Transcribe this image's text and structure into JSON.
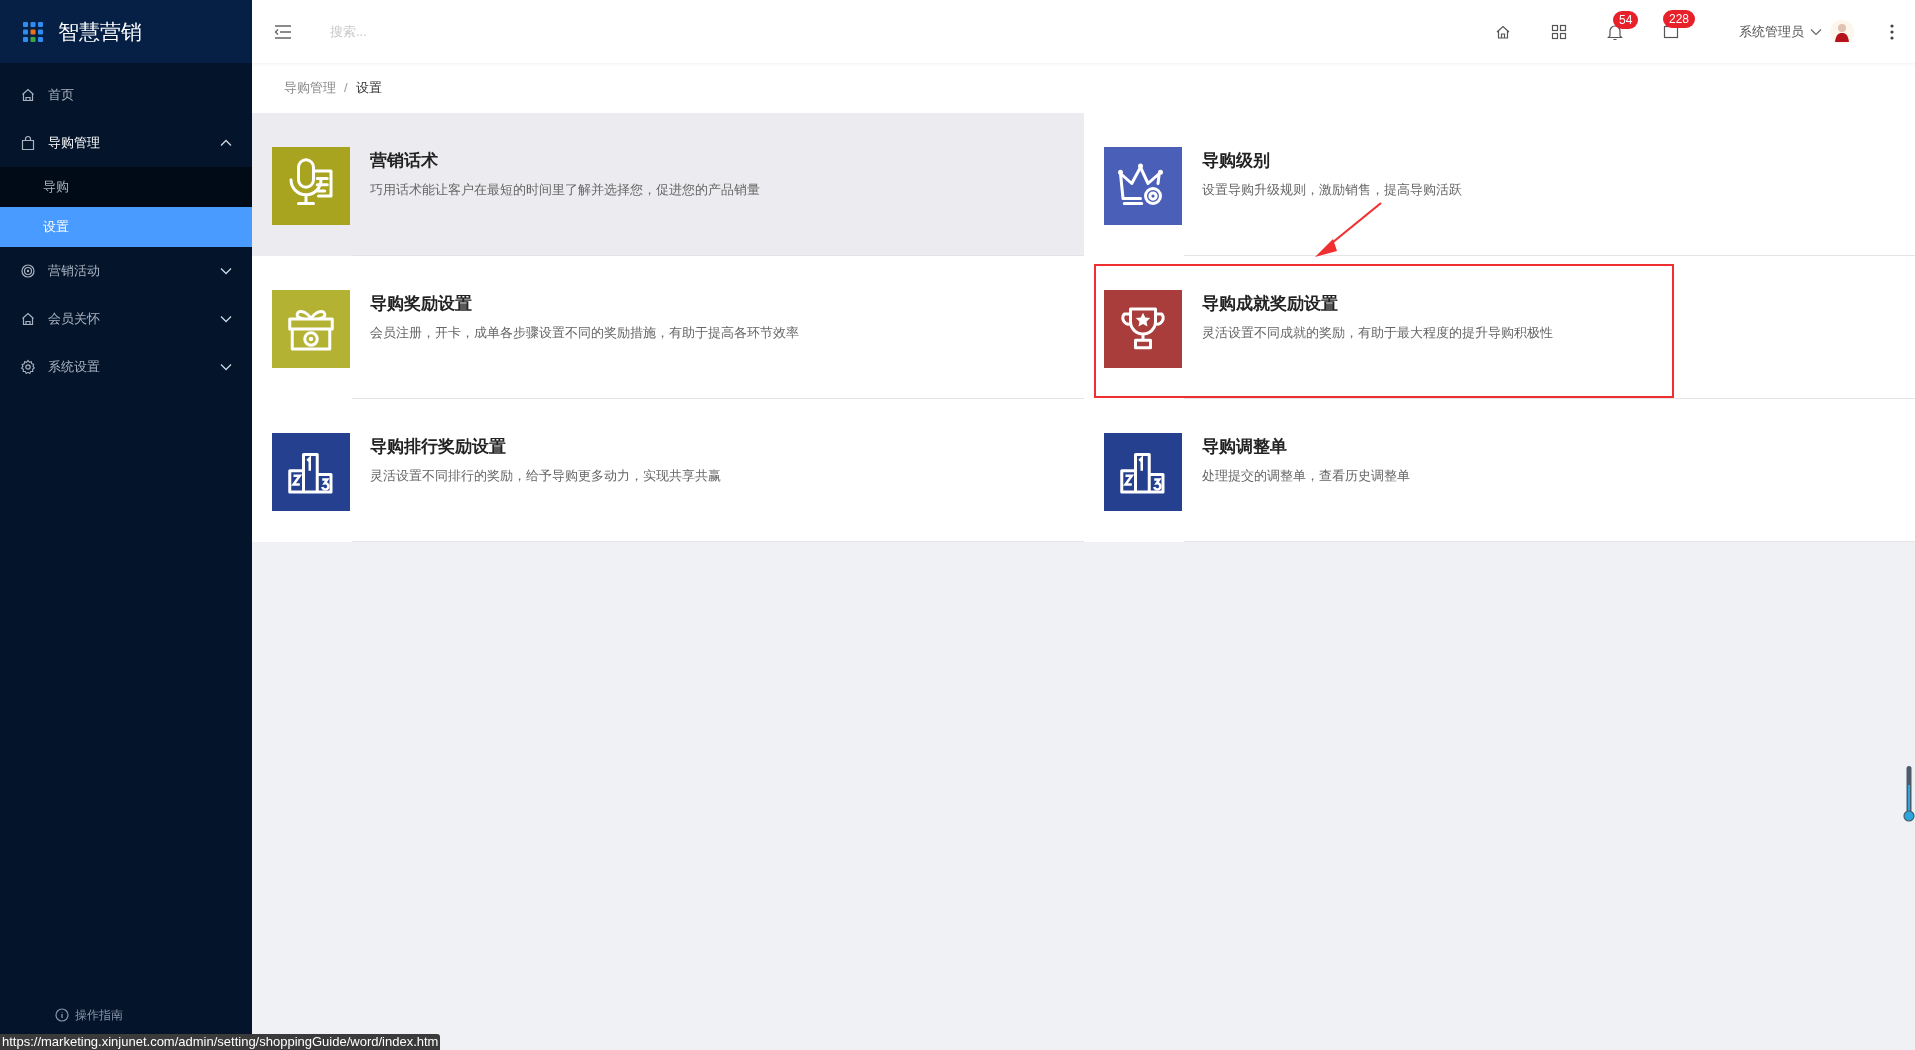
{
  "brand": "智慧营销",
  "sidebar": {
    "items": [
      {
        "label": "首页"
      },
      {
        "label": "导购管理",
        "expanded": true,
        "children": [
          {
            "label": "导购",
            "selected": false
          },
          {
            "label": "设置",
            "selected": true
          }
        ]
      },
      {
        "label": "营销活动",
        "expanded": false
      },
      {
        "label": "会员关怀",
        "expanded": false
      },
      {
        "label": "系统设置",
        "expanded": false
      }
    ],
    "footer_link": "操作指南"
  },
  "header": {
    "search": {
      "placeholder": "搜索..."
    },
    "notifications": "54",
    "messages": "228",
    "user": "系统管理员"
  },
  "breadcrumb": {
    "separator": "/",
    "items": [
      "导购管理",
      "设置"
    ]
  },
  "cards": [
    {
      "title": "营销话术",
      "description": "巧用话术能让客户在最短的时间里了解并选择您，促进您的产品销量",
      "color": "#a8a41f",
      "hovered": true,
      "annotated": false
    },
    {
      "title": "导购级别",
      "description": "设置导购升级规则，激励销售，提高导购活跃",
      "color": "#4a5fb8",
      "hovered": false,
      "annotated": false
    },
    {
      "title": "导购奖励设置",
      "description": "会员注册，开卡，成单各步骤设置不同的奖励措施，有助于提高各环节效率",
      "color": "#b4b233",
      "hovered": false,
      "annotated": false
    },
    {
      "title": "导购成就奖励设置",
      "description": "灵活设置不同成就的奖励，有助于最大程度的提升导购积极性",
      "color": "#a83d3b",
      "hovered": false,
      "annotated": true
    },
    {
      "title": "导购排行奖励设置",
      "description": "灵活设置不同排行的奖励，给予导购更多动力，实现共享共赢",
      "color": "#25408f",
      "hovered": false,
      "annotated": false
    },
    {
      "title": "导购调整单",
      "description": "处理提交的调整单，查看历史调整单",
      "color": "#25408f",
      "hovered": false,
      "annotated": false
    }
  ],
  "status_bar": "https://marketing.xinjunet.com/admin/setting/shoppingGuide/word/index.htm"
}
